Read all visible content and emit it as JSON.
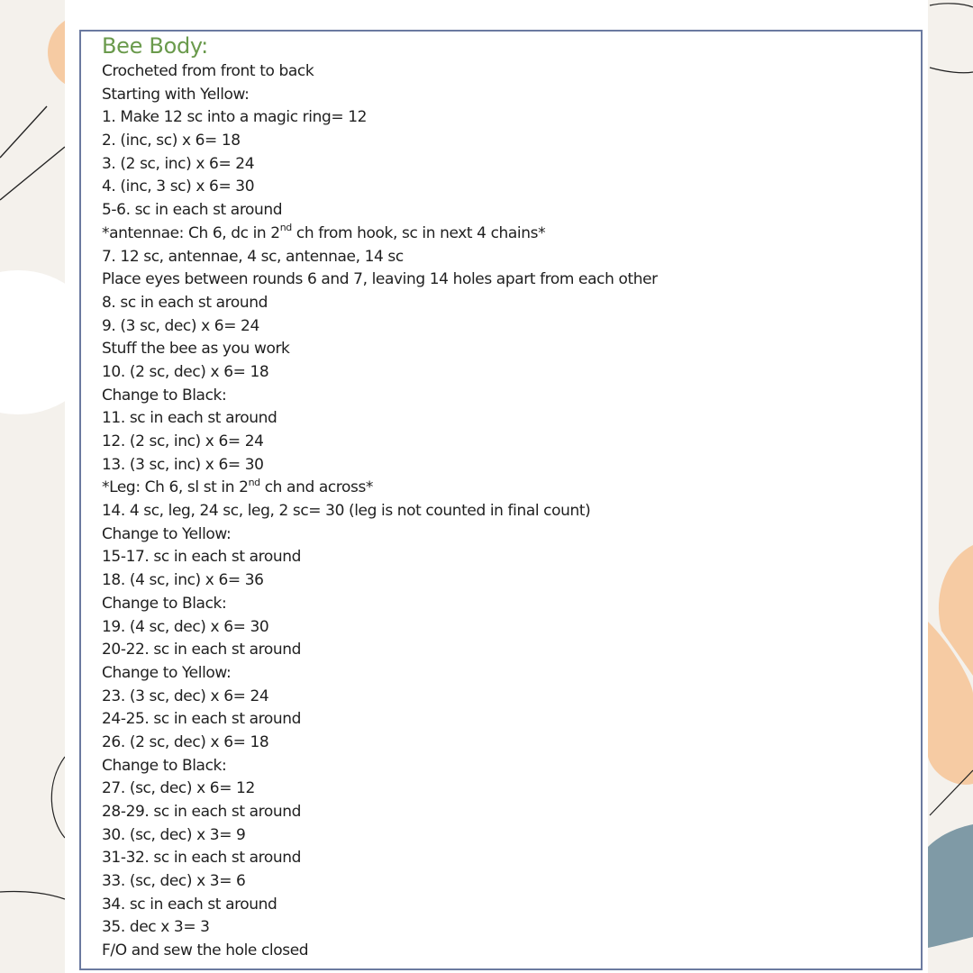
{
  "document": {
    "title": "Bee Body:",
    "lines": [
      {
        "text": "Crocheted from front to back"
      },
      {
        "text": "Starting with Yellow:"
      },
      {
        "text": "1. Make 12 sc into a magic ring= 12"
      },
      {
        "text": "2. (inc, sc) x 6= 18"
      },
      {
        "text": "3. (2 sc, inc) x 6= 24"
      },
      {
        "text": "4. (inc, 3 sc) x 6= 30"
      },
      {
        "text": "5-6. sc in each st around"
      },
      {
        "text": "*antennae: Ch 6, dc in 2",
        "sup": "nd",
        "after": " ch from hook, sc in next 4 chains*"
      },
      {
        "text": "7. 12 sc, antennae, 4 sc, antennae, 14 sc"
      },
      {
        "text": "Place eyes between rounds 6 and 7, leaving 14 holes apart from each other"
      },
      {
        "text": "8. sc in each st around"
      },
      {
        "text": "9. (3 sc, dec) x 6= 24"
      },
      {
        "text": "Stuff the bee as you work"
      },
      {
        "text": "10. (2 sc, dec) x 6= 18"
      },
      {
        "text": "Change to Black:"
      },
      {
        "text": "11. sc in each st around"
      },
      {
        "text": "12. (2 sc, inc) x 6= 24"
      },
      {
        "text": "13. (3 sc, inc) x 6= 30"
      },
      {
        "text": "*Leg: Ch 6, sl st in 2",
        "sup": "nd",
        "after": " ch and across*"
      },
      {
        "text": "14. 4 sc, leg, 24 sc, leg, 2 sc= 30 (leg is not counted in final count)"
      },
      {
        "text": "Change to Yellow:"
      },
      {
        "text": "15-17. sc in each st around"
      },
      {
        "text": "18. (4 sc, inc) x 6= 36"
      },
      {
        "text": "Change to Black:"
      },
      {
        "text": "19. (4 sc, dec) x 6= 30"
      },
      {
        "text": "20-22. sc in each st around"
      },
      {
        "text": "Change to Yellow:"
      },
      {
        "text": "23. (3 sc, dec) x 6= 24"
      },
      {
        "text": "24-25. sc in each st around"
      },
      {
        "text": "26. (2 sc, dec) x 6= 18"
      },
      {
        "text": "Change to Black:"
      },
      {
        "text": "27. (sc, dec) x 6= 12"
      },
      {
        "text": "28-29. sc in each st around"
      },
      {
        "text": "30. (sc, dec) x 3= 9"
      },
      {
        "text": "31-32. sc in each st around"
      },
      {
        "text": "33. (sc, dec) x 3= 6"
      },
      {
        "text": "34. sc in each st around"
      },
      {
        "text": "35. dec x 3= 3"
      },
      {
        "text": "F/O and sew the hole closed"
      }
    ]
  },
  "colors": {
    "title_green": "#6a9a4c",
    "frame_border": "#6b7aa0",
    "peach": "#f6cba3",
    "slate_blue": "#7f9aa6",
    "background": "#f4f1ec"
  }
}
